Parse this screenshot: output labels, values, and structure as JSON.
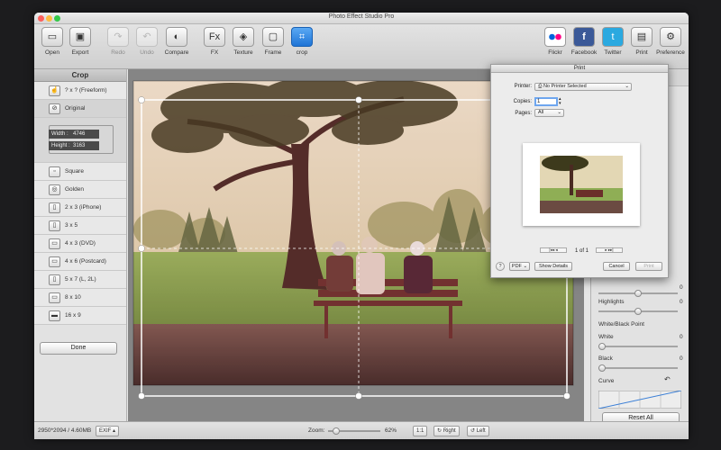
{
  "window": {
    "title": "Photo Effect Studio Pro"
  },
  "toolbar": {
    "left": [
      {
        "label": "Open",
        "glyph": "▭",
        "disabled": false
      },
      {
        "label": "Export",
        "glyph": "▣",
        "disabled": false
      },
      {
        "label": "Redo",
        "glyph": "↷",
        "disabled": true
      },
      {
        "label": "Undo",
        "glyph": "↶",
        "disabled": true
      },
      {
        "label": "Compare",
        "glyph": "◐",
        "disabled": false
      }
    ],
    "tools": [
      {
        "label": "FX",
        "glyph": "Fx"
      },
      {
        "label": "Texture",
        "glyph": "◈"
      },
      {
        "label": "Frame",
        "glyph": "▢"
      },
      {
        "label": "crop",
        "glyph": "⌗"
      }
    ],
    "right": [
      {
        "label": "Flickr",
        "glyph": "●●"
      },
      {
        "label": "Facebook",
        "glyph": "f"
      },
      {
        "label": "Twitter",
        "glyph": "t"
      },
      {
        "label": "Print",
        "glyph": "▤"
      },
      {
        "label": "Preference",
        "glyph": "⚙"
      }
    ]
  },
  "sidebar": {
    "title": "Crop",
    "freeform": "? x ?  (Freeform)",
    "original": "Original",
    "width_label": "Width :",
    "width_value": "4746",
    "height_label": "Height :",
    "height_value": "3163",
    "ratios": [
      "Square",
      "Golden",
      "2 x 3  (iPhone)",
      "3 x 5",
      "4 x 3  (DVD)",
      "4 x 6  (Postcard)",
      "5 x 7  (L, 2L)",
      "8 x 10",
      "16 x 9"
    ],
    "done": "Done"
  },
  "status": {
    "info": "2950*2094 / 4.60MB",
    "exif": "EXIF",
    "zoom_label": "Zoom:",
    "zoom_value": "62%",
    "zoom_fraction": 0.62,
    "one_to_one": "1:1",
    "right": "Right",
    "left": "Left"
  },
  "right_panel": {
    "highlights": "Highlights",
    "white_black": "White/Black Point",
    "white": "White",
    "black": "Black",
    "curve": "Curve",
    "zero": "0",
    "reset": "Reset All"
  },
  "print_dialog": {
    "title": "Print",
    "printer_label": "Printer:",
    "printer_value": "No Printer Selected",
    "copies_label": "Copies:",
    "copies_value": "1",
    "pages_label": "Pages:",
    "pages_value": "All",
    "page_count": "1 of 1",
    "help": "?",
    "pdf": "PDF",
    "show_details": "Show Details",
    "cancel": "Cancel",
    "print": "Print"
  },
  "colors": {
    "accent": "#1f74d6",
    "canvas": "#858585",
    "facebook": "#3b5998",
    "twitter": "#2aa9e0",
    "flickr_pink": "#ff0084",
    "flickr_blue": "#0063dc"
  }
}
